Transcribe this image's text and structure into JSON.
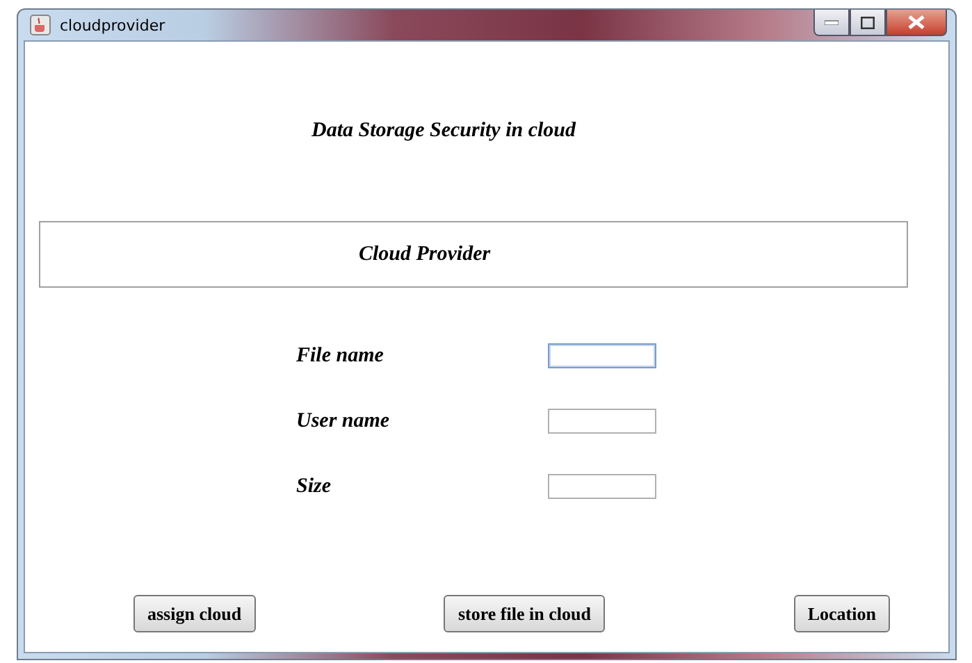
{
  "window": {
    "title": "cloudprovider"
  },
  "heading": "Data Storage Security in cloud",
  "panel": {
    "title": "Cloud Provider"
  },
  "fields": [
    {
      "label": "File name",
      "focused": true
    },
    {
      "label": "User name",
      "focused": false
    },
    {
      "label": "Size",
      "focused": false
    }
  ],
  "buttons": [
    "assign cloud",
    "store file in cloud",
    "Location"
  ]
}
